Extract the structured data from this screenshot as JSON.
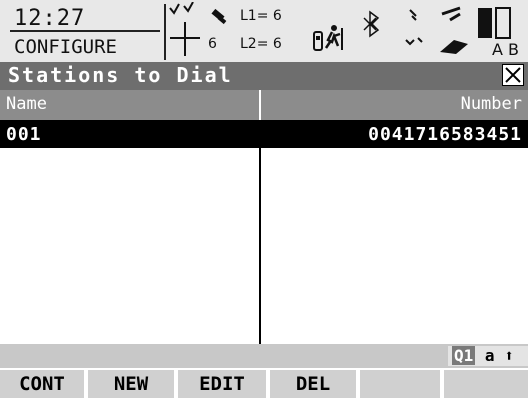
{
  "status": {
    "time": "12:27",
    "mode": "CONFIGURE",
    "sat_count_a": "6",
    "sat_count_b": "6",
    "l1_label": "L1= 6",
    "l2_label": "L2= 6",
    "bluetooth_glyph": "∗",
    "battery_label": "A B",
    "icons": [
      "gps-crosshair-icon",
      "satellite-icon",
      "phone-icon",
      "person-icon",
      "bluetooth-icon",
      "network-icon",
      "stylus-icon",
      "battery-icon"
    ]
  },
  "screen": {
    "title": "Stations to Dial",
    "close_label": "✕"
  },
  "table": {
    "columns": [
      "Name",
      "Number"
    ],
    "rows": [
      {
        "name": "001",
        "number": "0041716583451"
      }
    ]
  },
  "input_mode": {
    "q1": "Q1",
    "rest": "a",
    "arrow": "⬆"
  },
  "softkeys": [
    "CONT",
    "NEW",
    "EDIT",
    "DEL",
    "",
    ""
  ]
}
